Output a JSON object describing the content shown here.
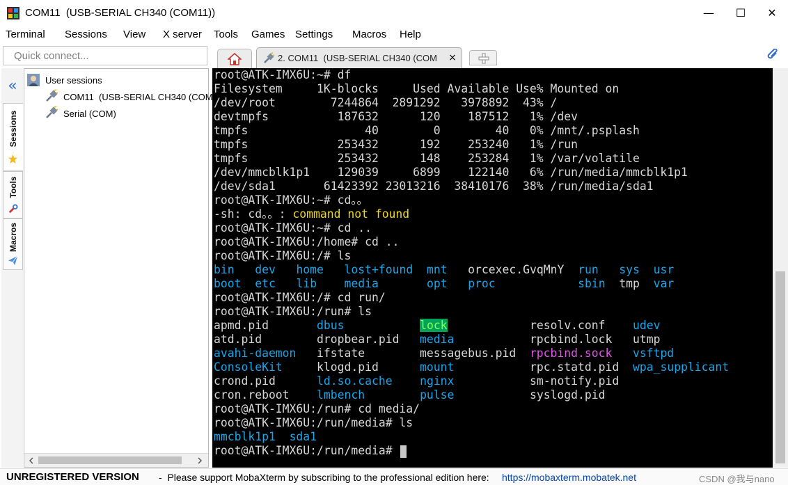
{
  "window": {
    "title": "COM11  (USB-SERIAL CH340 (COM11))",
    "controls": {
      "minimize": "—",
      "maximize": "☐",
      "close": "✕"
    }
  },
  "menu": [
    "Terminal",
    "Sessions",
    "View",
    "X server",
    "Tools",
    "Games",
    "Settings",
    "Macros",
    "Help"
  ],
  "quick_connect": {
    "placeholder": "Quick connect..."
  },
  "tabs": {
    "active_label": "2. COM11  (USB-SERIAL CH340 (COM",
    "close_glyph": "×"
  },
  "sidebar": {
    "collapse_glyph": "«",
    "tabs": [
      "Sessions",
      "Tools",
      "Macros"
    ],
    "tree": {
      "root": "User sessions",
      "items": [
        "COM11  (USB-SERIAL CH340 (COM1",
        "Serial (COM)"
      ]
    }
  },
  "colors": {
    "terminal_bg": "#000000",
    "text": "#d7d7d7",
    "dir": "#1aa5e8",
    "warn": "#f0d820",
    "socket": "#e155e8",
    "lock_bg": "#00a457",
    "lock_fg": "#8cff5a"
  },
  "terminal": {
    "lines": [
      [
        {
          "t": "root@ATK-IMX6U:~# df"
        }
      ],
      [
        {
          "t": "Filesystem     1K-blocks     Used Available Use% Mounted on"
        }
      ],
      [
        {
          "t": "/dev/root        7244864  2891292   3978892  43% /"
        }
      ],
      [
        {
          "t": "devtmpfs          187632      120    187512   1% /dev"
        }
      ],
      [
        {
          "t": "tmpfs                 40        0        40   0% /mnt/.psplash"
        }
      ],
      [
        {
          "t": "tmpfs             253432      192    253240   1% /run"
        }
      ],
      [
        {
          "t": "tmpfs             253432      148    253284   1% /var/volatile"
        }
      ],
      [
        {
          "t": "/dev/mmcblk1p1    129039     6899    122140   6% /run/media/mmcblk1p1"
        }
      ],
      [
        {
          "t": "/dev/sda1       61423392 23013216  38410176  38% /run/media/sda1"
        }
      ],
      [
        {
          "t": "root@ATK-IMX6U:~# cd。。"
        }
      ],
      [
        {
          "t": "-sh: cd。。: "
        },
        {
          "t": "command not found",
          "c": "warn"
        }
      ],
      [
        {
          "t": "root@ATK-IMX6U:~# cd .."
        }
      ],
      [
        {
          "t": "root@ATK-IMX6U:/home# cd .."
        }
      ],
      [
        {
          "t": "root@ATK-IMX6U:/# ls"
        }
      ],
      [
        {
          "t": "bin",
          "c": "dir"
        },
        {
          "t": "   "
        },
        {
          "t": "dev",
          "c": "dir"
        },
        {
          "t": "   "
        },
        {
          "t": "home",
          "c": "dir"
        },
        {
          "t": "   "
        },
        {
          "t": "lost+found",
          "c": "dir"
        },
        {
          "t": "  "
        },
        {
          "t": "mnt",
          "c": "dir"
        },
        {
          "t": "   orcexec.GvqMnY  "
        },
        {
          "t": "run",
          "c": "dir"
        },
        {
          "t": "   "
        },
        {
          "t": "sys",
          "c": "dir"
        },
        {
          "t": "  "
        },
        {
          "t": "usr",
          "c": "dir"
        }
      ],
      [
        {
          "t": "boot",
          "c": "dir"
        },
        {
          "t": "  "
        },
        {
          "t": "etc",
          "c": "dir"
        },
        {
          "t": "   "
        },
        {
          "t": "lib",
          "c": "dir"
        },
        {
          "t": "    "
        },
        {
          "t": "media",
          "c": "dir"
        },
        {
          "t": "       "
        },
        {
          "t": "opt",
          "c": "dir"
        },
        {
          "t": "   "
        },
        {
          "t": "proc",
          "c": "dir"
        },
        {
          "t": "            "
        },
        {
          "t": "sbin",
          "c": "dir"
        },
        {
          "t": "  tmp  "
        },
        {
          "t": "var",
          "c": "dir"
        }
      ],
      [
        {
          "t": "root@ATK-IMX6U:/# cd run/"
        }
      ],
      [
        {
          "t": "root@ATK-IMX6U:/run# ls"
        }
      ],
      [
        {
          "t": "apmd.pid       "
        },
        {
          "t": "dbus",
          "c": "dir"
        },
        {
          "t": "           "
        },
        {
          "t": "lock",
          "c": "lock"
        },
        {
          "t": "            resolv.conf    "
        },
        {
          "t": "udev",
          "c": "dir"
        }
      ],
      [
        {
          "t": "atd.pid        dropbear.pid   "
        },
        {
          "t": "media",
          "c": "dir"
        },
        {
          "t": "           rpcbind.lock   utmp"
        }
      ],
      [
        {
          "t": "avahi-daemon",
          "c": "dir"
        },
        {
          "t": "   ifstate        messagebus.pid  "
        },
        {
          "t": "rpcbind.sock",
          "c": "socket"
        },
        {
          "t": "   "
        },
        {
          "t": "vsftpd",
          "c": "dir"
        }
      ],
      [
        {
          "t": "ConsoleKit",
          "c": "dir"
        },
        {
          "t": "     klogd.pid      "
        },
        {
          "t": "mount",
          "c": "dir"
        },
        {
          "t": "           rpc.statd.pid  "
        },
        {
          "t": "wpa_supplicant",
          "c": "dir"
        }
      ],
      [
        {
          "t": "crond.pid      "
        },
        {
          "t": "ld.so.cache",
          "c": "dir"
        },
        {
          "t": "    "
        },
        {
          "t": "nginx",
          "c": "dir"
        },
        {
          "t": "           sm-notify.pid"
        }
      ],
      [
        {
          "t": "cron.reboot    "
        },
        {
          "t": "lmbench",
          "c": "dir"
        },
        {
          "t": "        "
        },
        {
          "t": "pulse",
          "c": "dir"
        },
        {
          "t": "           syslogd.pid"
        }
      ],
      [
        {
          "t": "root@ATK-IMX6U:/run# cd media/"
        }
      ],
      [
        {
          "t": "root@ATK-IMX6U:/run/media# ls"
        }
      ],
      [
        {
          "t": "mmcblk1p1",
          "c": "dir"
        },
        {
          "t": "  "
        },
        {
          "t": "sda1",
          "c": "dir"
        }
      ],
      [
        {
          "t": "root@ATK-IMX6U:/run/media# "
        },
        {
          "cursor": true
        }
      ]
    ]
  },
  "status": {
    "unregistered": "UNREGISTERED VERSION",
    "message": "-  Please support MobaXterm by subscribing to the professional edition here:",
    "link": "https://mobaxterm.mobatek.net",
    "watermark": "CSDN @我与nano"
  }
}
